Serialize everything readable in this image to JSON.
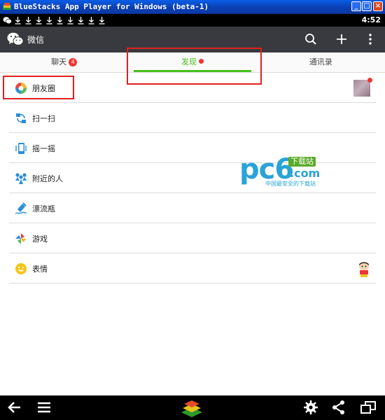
{
  "window": {
    "title": "BlueStacks App Player for Windows (beta-1)",
    "buttons": [
      "_",
      "□",
      "×"
    ]
  },
  "status_bar": {
    "time": "4:52",
    "notification_icons": [
      "wechat-icon",
      "download-icon",
      "download-icon",
      "download-icon",
      "download-icon",
      "download-icon",
      "download-icon",
      "download-icon",
      "download-icon",
      "download-icon"
    ]
  },
  "action_bar": {
    "title": "微信",
    "actions": [
      "search-icon",
      "plus-icon",
      "more-icon"
    ]
  },
  "tabs": [
    {
      "label": "聊天",
      "badge": "4"
    },
    {
      "label": "发现",
      "dot": true,
      "active": true
    },
    {
      "label": "通讯录"
    }
  ],
  "discover_items": [
    {
      "label": "朋友圈",
      "icon": "moments-icon"
    },
    {
      "label": "扫一扫",
      "icon": "scan-icon"
    },
    {
      "label": "摇一摇",
      "icon": "shake-icon"
    },
    {
      "label": "附近的人",
      "icon": "people-nearby-icon"
    },
    {
      "label": "漂流瓶",
      "icon": "drift-bottle-icon"
    },
    {
      "label": "游戏",
      "icon": "games-icon"
    },
    {
      "label": "表情",
      "icon": "sticker-icon"
    }
  ],
  "watermark": {
    "brand": "pc6",
    "badge": "下载站",
    "domain": ".com",
    "tagline": "中国最安全的下载站"
  },
  "nav_bar": [
    "back-icon",
    "menu-icon",
    "bluestacks-logo",
    "settings-icon",
    "share-icon",
    "window-icon"
  ],
  "colors": {
    "accent_green": "#45c01a",
    "action_bar": "#393a3f",
    "badge_red": "#f43530",
    "annotation_red": "#e02020"
  }
}
